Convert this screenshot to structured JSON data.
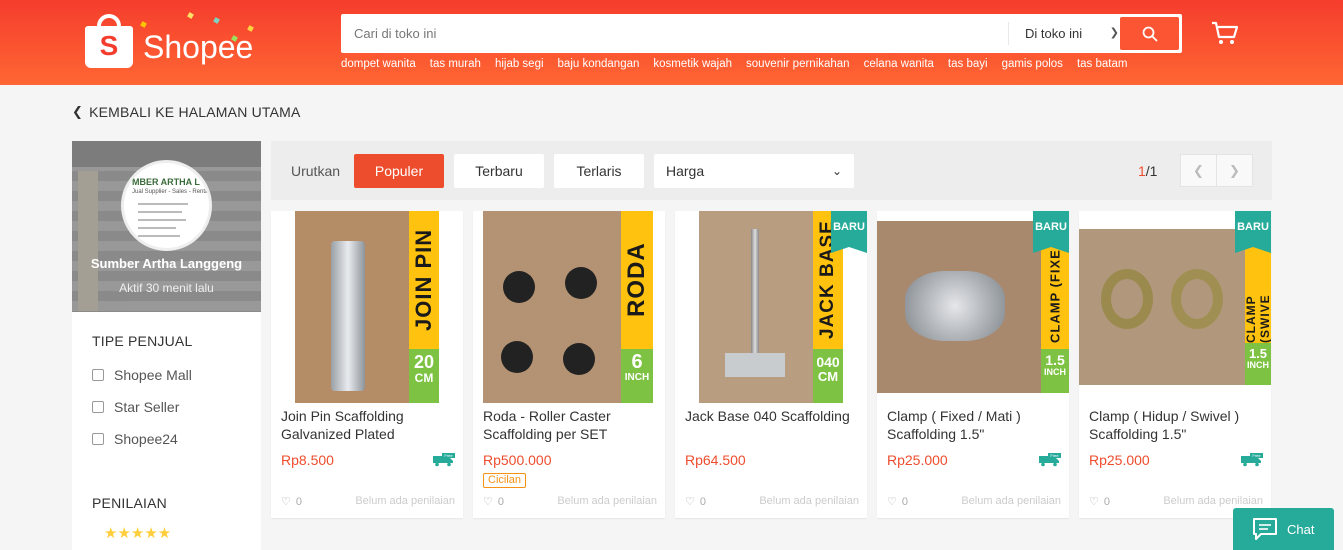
{
  "header": {
    "logo_text": "Shopee",
    "logo_letter": "S",
    "search_placeholder": "Cari di toko ini",
    "search_scope": "Di toko ini",
    "keywords": [
      "dompet wanita",
      "tas murah",
      "hijab segi",
      "baju kondangan",
      "kosmetik wajah",
      "souvenir pernikahan",
      "celana wanita",
      "tas bayi",
      "gamis polos",
      "tas batam"
    ],
    "brand_color": "#f53d2d"
  },
  "back_link": "KEMBALI KE HALAMAN UTAMA",
  "shop": {
    "name": "Sumber Artha Langgeng",
    "active": "Aktif 30 menit lalu",
    "logo_line1": "MBER ARTHA L",
    "logo_line2": "Jual Supplier - Sales - Rental"
  },
  "filters": {
    "seller_type_title": "TIPE PENJUAL",
    "seller_types": [
      "Shopee Mall",
      "Star Seller",
      "Shopee24"
    ],
    "rating_title": "PENILAIAN",
    "stars": "★★★★★"
  },
  "sort": {
    "label": "Urutkan",
    "options": [
      "Populer",
      "Terbaru",
      "Terlaris"
    ],
    "active": "Populer",
    "price_label": "Harga",
    "page_current": "1",
    "page_total": "/1"
  },
  "products": [
    {
      "name": "Join Pin Scaffolding Galvanized Plated",
      "price": "Rp8.500",
      "banner": "JOIN PIN",
      "size": "20",
      "unit": "CM",
      "is_new": false,
      "free_shipping": true,
      "cicilan": false,
      "likes": "0",
      "rating": "Belum ada penilaian"
    },
    {
      "name": "Roda - Roller Caster Scaffolding per SET",
      "price": "Rp500.000",
      "banner": "RODA",
      "size": "6",
      "unit": "INCH",
      "is_new": false,
      "free_shipping": false,
      "cicilan": true,
      "cicilan_label": "Cicilan",
      "likes": "0",
      "rating": "Belum ada penilaian"
    },
    {
      "name": "Jack Base 040 Scaffolding",
      "price": "Rp64.500",
      "banner": "JACK BASE",
      "size": "040",
      "unit": "CM",
      "is_new": true,
      "free_shipping": false,
      "cicilan": false,
      "likes": "0",
      "rating": "Belum ada penilaian"
    },
    {
      "name": "Clamp ( Fixed / Mati ) Scaffolding 1.5\"",
      "price": "Rp25.000",
      "banner": "CLAMP (FIXE",
      "size": "1.5",
      "unit": "INCH",
      "is_new": true,
      "free_shipping": true,
      "cicilan": false,
      "likes": "0",
      "rating": "Belum ada penilaian"
    },
    {
      "name": "Clamp ( Hidup / Swivel ) Scaffolding 1.5\"",
      "price": "Rp25.000",
      "banner": "CLAMP (SWIVE",
      "size": "1.5",
      "unit": "INCH",
      "is_new": true,
      "free_shipping": true,
      "cicilan": false,
      "likes": "0",
      "rating": "Belum ada penilaian"
    }
  ],
  "new_badge": "BARU",
  "free_label": "Free",
  "chat_label": "Chat"
}
